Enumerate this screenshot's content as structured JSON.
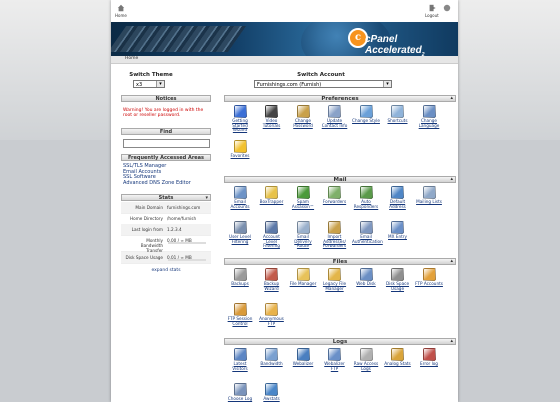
{
  "header": {
    "home_label": "Home",
    "logout_label": "Logout",
    "brand_mark": "c",
    "brand_prefix": "cPanel",
    "brand_suffix": "Accelerated",
    "brand_version": "2"
  },
  "breadcrumb": "Home",
  "switch_theme": {
    "label": "Switch Theme",
    "value": "x3"
  },
  "switch_account": {
    "label": "Switch Account",
    "value": "Furnishings.com (Furnish)"
  },
  "notices": {
    "title": "Notices",
    "text": "Warning! You are logged in with the root or reseller password."
  },
  "find": {
    "title": "Find",
    "value": ""
  },
  "frequent": {
    "title": "Frequently Accessed Areas",
    "links": [
      "SSL/TLS Manager",
      "Email Accounts",
      "SSL Software",
      "Advanced DNS Zone Editor"
    ]
  },
  "stats": {
    "title": "Stats",
    "rows": [
      {
        "key": "Main Domain",
        "value": "furnishings.com"
      },
      {
        "key": "Home Directory",
        "value": "/home/furnish"
      },
      {
        "key": "Last login from",
        "value": "1.2.3.4"
      },
      {
        "key": "Monthly Bandwidth Transfer",
        "value": "0.00 / ∞ MB"
      },
      {
        "key": "Disk Space Usage",
        "value": "0.01 / ∞ MB"
      }
    ],
    "expand_label": "expand stats"
  },
  "colors": {
    "link": "#14367a",
    "warning": "#cc0000",
    "banner": "#123e66",
    "accent": "#f7931e"
  },
  "sections": [
    {
      "title": "Preferences",
      "items": [
        {
          "name": "getting-started-icon",
          "label": "Getting Started Wizard",
          "color": "#3b6fd6"
        },
        {
          "name": "video-tutorials-icon",
          "label": "Video Tutorials",
          "color": "#444444"
        },
        {
          "name": "change-password-icon",
          "label": "Change Password",
          "color": "#c9a14a"
        },
        {
          "name": "contact-info-icon",
          "label": "Update Contact Info",
          "color": "#8aa2c8"
        },
        {
          "name": "change-style-icon",
          "label": "Change Style",
          "color": "#6aa0d8"
        },
        {
          "name": "shortcuts-icon",
          "label": "Shortcuts",
          "color": "#8fb3d9"
        },
        {
          "name": "change-language-icon",
          "label": "Change Language",
          "color": "#6b8fc4"
        },
        {
          "name": "favorites-icon",
          "label": "Favorites",
          "color": "#f2c12e"
        }
      ]
    },
    {
      "title": "Mail",
      "items": [
        {
          "name": "email-accounts-icon",
          "label": "Email Accounts",
          "color": "#6d93c7"
        },
        {
          "name": "boxtrapper-icon",
          "label": "BoxTrapper",
          "color": "#e7c24a"
        },
        {
          "name": "spam-assassin-icon",
          "label": "Spam Assassin™",
          "color": "#4c9a3a"
        },
        {
          "name": "forwarders-icon",
          "label": "Forwarders",
          "color": "#7fb06a"
        },
        {
          "name": "auto-responders-icon",
          "label": "Auto Responders",
          "color": "#5a9a4a"
        },
        {
          "name": "default-address-icon",
          "label": "Default Address",
          "color": "#4f86c6"
        },
        {
          "name": "mailing-lists-icon",
          "label": "Mailing Lists",
          "color": "#8fa8c8"
        },
        {
          "name": "user-level-filtering-icon",
          "label": "User Level Filtering",
          "color": "#7a8fae"
        },
        {
          "name": "account-level-filtering-icon",
          "label": "Account Level Filtering",
          "color": "#5c79a8"
        },
        {
          "name": "email-delivery-route-icon",
          "label": "Email Delivery Route",
          "color": "#9ab0cc"
        },
        {
          "name": "import-addresses-icon",
          "label": "Import Addresses/ Forwarders",
          "color": "#c9a14a"
        },
        {
          "name": "email-authentication-icon",
          "label": "Email Authentication",
          "color": "#7f97bf"
        },
        {
          "name": "mx-entry-icon",
          "label": "MX Entry",
          "color": "#6a8fc7"
        }
      ]
    },
    {
      "title": "Files",
      "items": [
        {
          "name": "backups-icon",
          "label": "Backups",
          "color": "#9a9a9a"
        },
        {
          "name": "backup-wizard-icon",
          "label": "Backup Wizard",
          "color": "#c25a4a"
        },
        {
          "name": "file-manager-icon",
          "label": "File Manager",
          "color": "#e8c25a"
        },
        {
          "name": "legacy-file-manager-icon",
          "label": "Legacy File Manager",
          "color": "#e3b64a"
        },
        {
          "name": "web-disk-icon",
          "label": "Web Disk",
          "color": "#6b8fc4"
        },
        {
          "name": "disk-space-usage-icon",
          "label": "Disk Space Usage",
          "color": "#8f8f8f"
        },
        {
          "name": "ftp-accounts-icon",
          "label": "FTP Accounts",
          "color": "#e3a13a"
        },
        {
          "name": "ftp-session-control-icon",
          "label": "FTP Session Control",
          "color": "#d99a3a"
        },
        {
          "name": "anonymous-ftp-icon",
          "label": "Anonymous FTP",
          "color": "#e8b24a"
        }
      ]
    },
    {
      "title": "Logs",
      "items": [
        {
          "name": "latest-visitors-icon",
          "label": "Latest Visitors",
          "color": "#5c86c4"
        },
        {
          "name": "bandwidth-icon",
          "label": "Bandwidth",
          "color": "#7aa0d0"
        },
        {
          "name": "webalizer-icon",
          "label": "Webalizer",
          "color": "#4a7fc0"
        },
        {
          "name": "webalizer-ftp-icon",
          "label": "Webalizer FTP",
          "color": "#6a90c8"
        },
        {
          "name": "raw-access-logs-icon",
          "label": "Raw Access Logs",
          "color": "#b0b0b0"
        },
        {
          "name": "analog-stats-icon",
          "label": "Analog Stats",
          "color": "#d9a43a"
        },
        {
          "name": "error-log-icon",
          "label": "Error log",
          "color": "#c0504a"
        },
        {
          "name": "choose-log-programs-icon",
          "label": "Choose Log Programs",
          "color": "#7a93bb"
        },
        {
          "name": "awstats-icon",
          "label": "Awstats",
          "color": "#4a86c8"
        }
      ]
    }
  ]
}
